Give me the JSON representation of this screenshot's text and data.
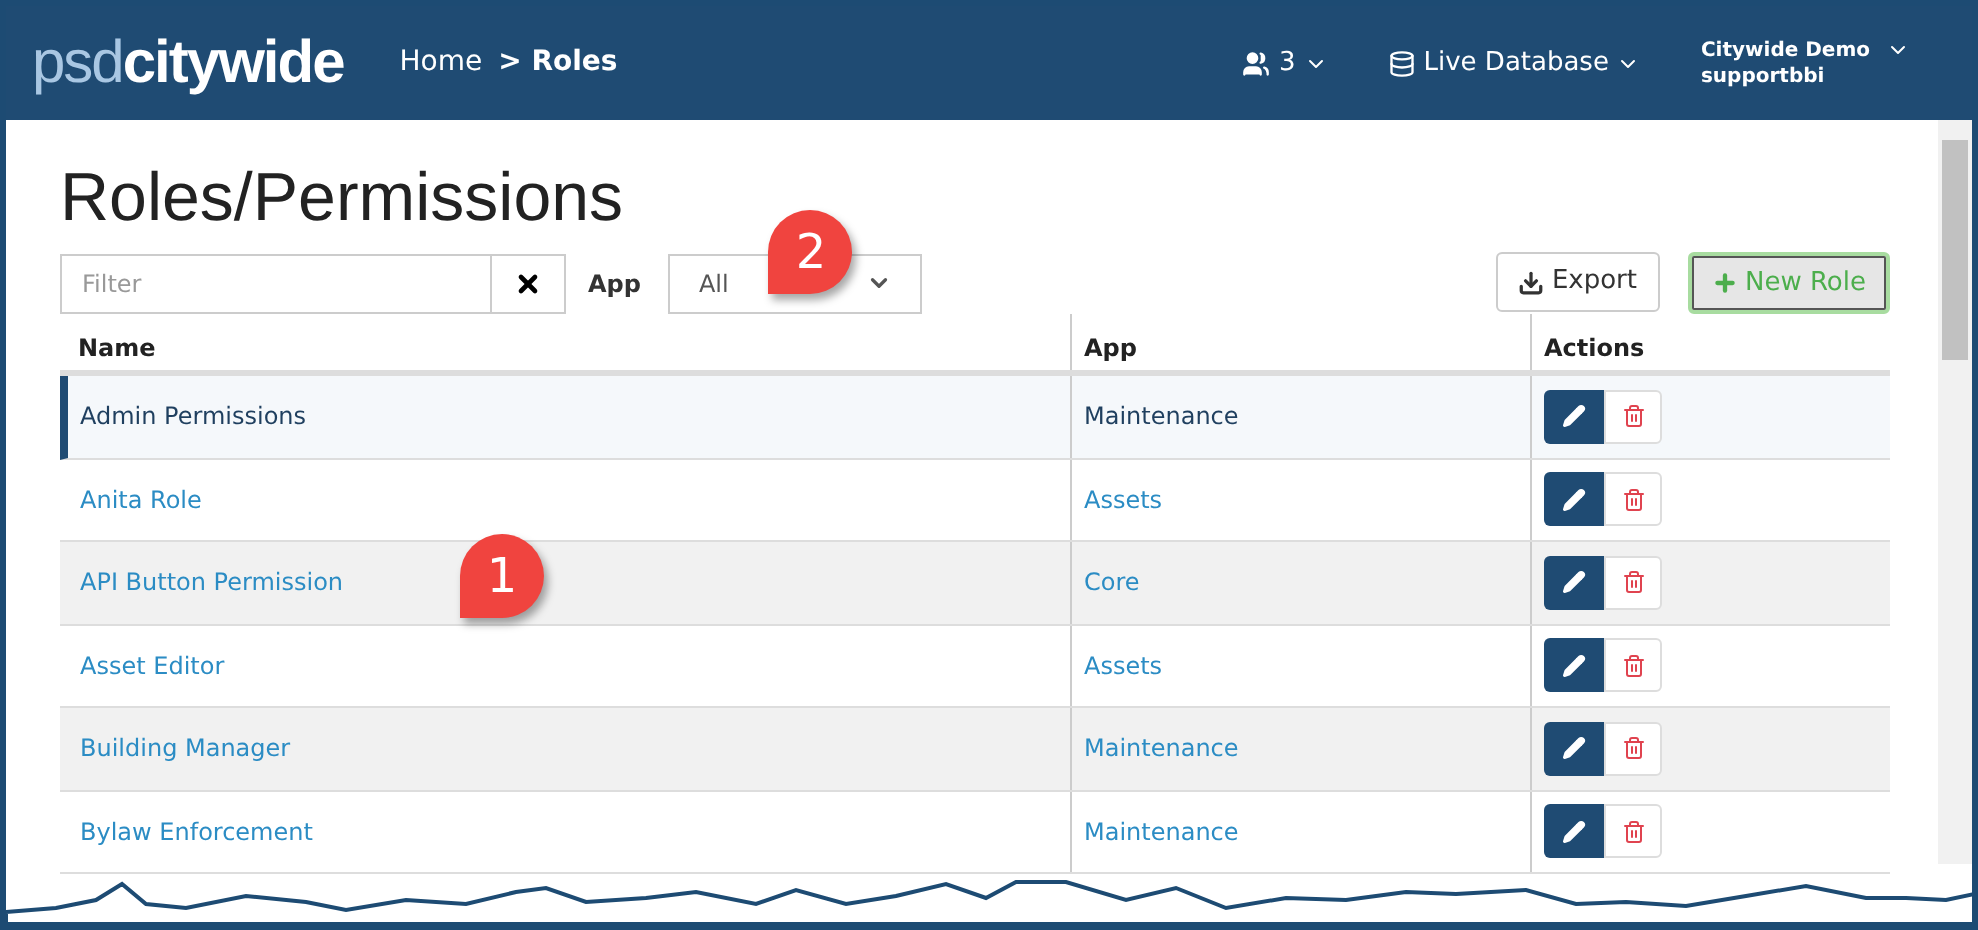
{
  "header": {
    "logo_light": "psd",
    "logo_bold": "citywide",
    "breadcrumb": [
      {
        "label": "Home",
        "current": false
      },
      {
        "label": "> Roles",
        "current": true
      }
    ],
    "users_count": "3",
    "database": "Live Database",
    "account": {
      "name": "Citywide Demo",
      "user": "supportbbi"
    }
  },
  "page_title": "Roles/Permissions",
  "filter": {
    "placeholder": "Filter"
  },
  "app_filter": {
    "label": "App",
    "value": "All"
  },
  "buttons": [
    {
      "kind": "export",
      "label": "Export"
    },
    {
      "kind": "new",
      "label": "New Role"
    }
  ],
  "table": {
    "columns": [
      "Name",
      "App",
      "Actions"
    ],
    "rows": [
      {
        "name": "Admin Permissions",
        "app": "Maintenance",
        "selected": true
      },
      {
        "name": "Anita Role",
        "app": "Assets",
        "selected": false
      },
      {
        "name": "API Button Permission",
        "app": "Core",
        "selected": false
      },
      {
        "name": "Asset Editor",
        "app": "Assets",
        "selected": false
      },
      {
        "name": "Building Manager",
        "app": "Maintenance",
        "selected": false
      },
      {
        "name": "Bylaw Enforcement",
        "app": "Maintenance",
        "selected": false
      }
    ]
  },
  "callouts": [
    {
      "label": "1"
    },
    {
      "label": "2"
    }
  ]
}
